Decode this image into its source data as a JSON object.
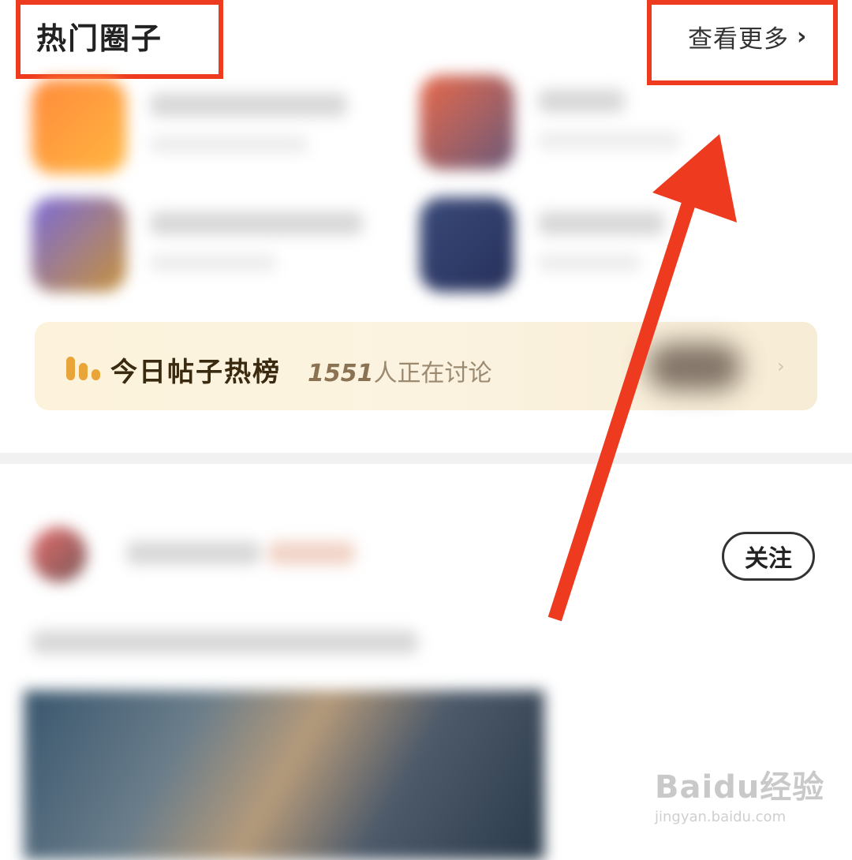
{
  "header": {
    "title": "热门圈子",
    "see_more_label": "查看更多",
    "chevron_glyph": "›"
  },
  "hot_list": {
    "title": "今日帖子热榜",
    "count": "1551",
    "count_suffix": "人正在讨论",
    "chevron_glyph": "›"
  },
  "post": {
    "follow_label": "关注"
  },
  "watermark": {
    "brand": "Baidu经验",
    "url": "jingyan.baidu.com"
  },
  "colors": {
    "annotation_red": "#ee3a1e",
    "hot_bar": "#e9a43a"
  },
  "icons": [
    "chevron-right-icon",
    "hot-rank-bars-icon",
    "annotation-arrow"
  ]
}
